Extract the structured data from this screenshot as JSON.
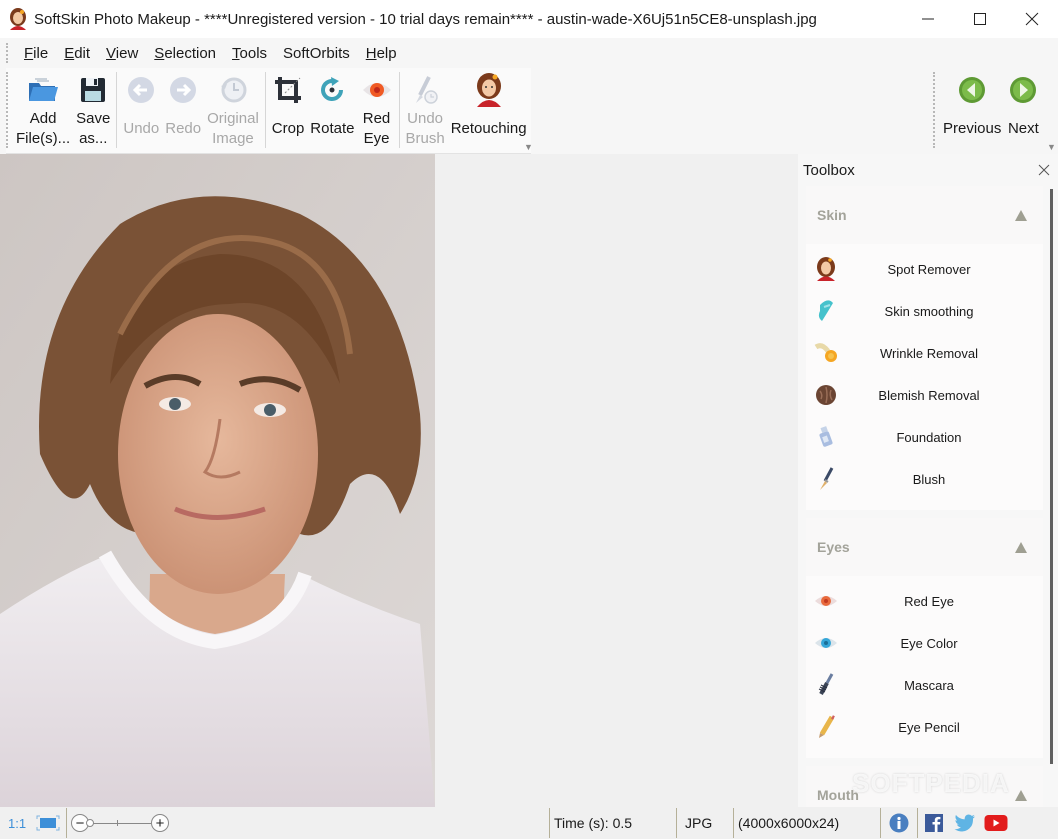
{
  "window": {
    "title": "SoftSkin Photo Makeup - ****Unregistered version - 10 trial days remain**** - austin-wade-X6Uj51n5CE8-unsplash.jpg",
    "minimize_icon": "minimize-icon",
    "maximize_icon": "maximize-icon",
    "close_icon": "close-icon"
  },
  "menu": {
    "items": [
      {
        "key": "F",
        "rest": "ile"
      },
      {
        "key": "E",
        "rest": "dit"
      },
      {
        "key": "V",
        "rest": "iew"
      },
      {
        "key": "S",
        "rest": "election"
      },
      {
        "key": "T",
        "rest": "ools"
      },
      {
        "key": "",
        "rest": "SoftOrbits"
      },
      {
        "key": "H",
        "rest": "elp"
      }
    ]
  },
  "toolbar": {
    "add_files": {
      "line1": "Add",
      "line2": "File(s)...",
      "icon": "folder-open-icon",
      "enabled": true
    },
    "save_as": {
      "line1": "Save",
      "line2": "as...",
      "icon": "floppy-disk-icon",
      "enabled": true
    },
    "undo": {
      "line1": "Undo",
      "icon": "undo-arrow-icon",
      "enabled": false
    },
    "redo": {
      "line1": "Redo",
      "icon": "redo-arrow-icon",
      "enabled": false
    },
    "original_image": {
      "line1": "Original",
      "line2": "Image",
      "icon": "history-clock-icon",
      "enabled": false
    },
    "crop": {
      "line1": "Crop",
      "icon": "crop-icon",
      "enabled": true
    },
    "rotate": {
      "line1": "Rotate",
      "icon": "rotate-icon",
      "enabled": true
    },
    "red_eye": {
      "line1": "Red",
      "line2": "Eye",
      "icon": "red-eye-icon",
      "enabled": true
    },
    "undo_brush": {
      "line1": "Undo",
      "line2": "Brush",
      "icon": "undo-brush-icon",
      "enabled": false
    },
    "retouching": {
      "line1": "Retouching",
      "icon": "retouching-woman-icon",
      "enabled": true
    },
    "previous": {
      "line1": "Previous",
      "icon": "previous-green-icon",
      "enabled": true
    },
    "next": {
      "line1": "Next",
      "icon": "next-green-icon",
      "enabled": true
    }
  },
  "toolbox": {
    "title": "Toolbox",
    "sections": [
      {
        "title": "Skin",
        "items": [
          {
            "label": "Spot Remover",
            "icon": "woman-face-icon"
          },
          {
            "label": "Skin smoothing",
            "icon": "smoothing-brush-icon"
          },
          {
            "label": "Wrinkle Removal",
            "icon": "wrinkle-brush-icon"
          },
          {
            "label": "Blemish Removal",
            "icon": "blemish-sponge-icon"
          },
          {
            "label": "Foundation",
            "icon": "foundation-bottle-icon"
          },
          {
            "label": "Blush",
            "icon": "blush-brush-icon"
          }
        ]
      },
      {
        "title": "Eyes",
        "items": [
          {
            "label": "Red Eye",
            "icon": "red-eye-icon"
          },
          {
            "label": "Eye Color",
            "icon": "blue-eye-icon"
          },
          {
            "label": "Mascara",
            "icon": "mascara-wand-icon"
          },
          {
            "label": "Eye Pencil",
            "icon": "pencil-icon"
          }
        ]
      },
      {
        "title": "Mouth",
        "items": []
      }
    ]
  },
  "watermark": "SOFTPEDIA",
  "statusbar": {
    "zoom_1to1": "1:1",
    "fit_icon": "fit-to-window-icon",
    "zoom_out": "−",
    "zoom_in": "+",
    "zoom_level_fraction": 0.0,
    "time": "Time (s): 0.5",
    "format": "JPG",
    "dimensions": "(4000x6000x24)",
    "info_icon": "info-icon",
    "facebook_icon": "facebook-icon",
    "twitter_icon": "twitter-icon",
    "youtube_icon": "youtube-icon"
  },
  "colors": {
    "accent_green": "#6aa83e",
    "disabled_text": "#a8a8a8",
    "section_title": "#a3a39a",
    "zoom_blue": "#3d8fd8",
    "youtube_red": "#e21c1c",
    "facebook_blue": "#3b5a9a",
    "twitter_blue": "#5fb4e4"
  }
}
